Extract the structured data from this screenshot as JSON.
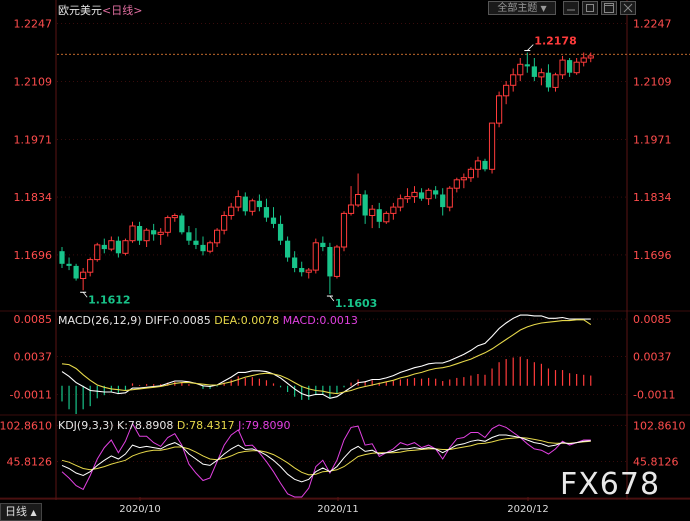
{
  "header": {
    "instrument": "欧元美元",
    "interval": "<日线>",
    "theme_button": "全部主题",
    "dropdown_glyph": "▼"
  },
  "macd_header": {
    "name": "MACD(26,12,9)",
    "diff": "DIFF:0.0085",
    "dea": "DEA:0.0078",
    "macd": "MACD:0.0013"
  },
  "kdj_header": {
    "name": "KDJ(9,3,3)",
    "k": "K:78.8908",
    "d": "D:78.4317",
    "j": "J:79.8090"
  },
  "period_button": "日线",
  "brand": "FX678",
  "colors": {
    "up": "#ff3b3b",
    "down": "#18c48a",
    "diff_line": "#ffffff",
    "dea_line": "#e6d84a",
    "j_line": "#e040e0",
    "axis_text": "#ff4d4d",
    "grid": "#5a1414"
  },
  "chart_data": [
    {
      "type": "candlestick",
      "title": "欧元美元<日线>",
      "y_ticks": [
        "1.2247",
        "1.2109",
        "1.1971",
        "1.1834",
        "1.1696"
      ],
      "ylim": [
        1.1565,
        1.2265
      ],
      "last_price_line": 1.2174,
      "annotations": [
        {
          "label": "1.2178",
          "value": 1.2178,
          "color": "#ff3b3b"
        },
        {
          "label": "1.1612",
          "value": 1.1612,
          "color": "#18c48a"
        },
        {
          "label": "1.1603",
          "value": 1.1603,
          "color": "#18c48a"
        }
      ],
      "x_labels": [
        "2020/10",
        "2020/11",
        "2020/12"
      ],
      "candles": [
        [
          1.1705,
          1.1715,
          1.1665,
          1.1675
        ],
        [
          1.1675,
          1.169,
          1.166,
          1.167
        ],
        [
          1.167,
          1.1675,
          1.1635,
          1.164
        ],
        [
          1.164,
          1.1665,
          1.1612,
          1.1655
        ],
        [
          1.1655,
          1.169,
          1.1645,
          1.1685
        ],
        [
          1.1685,
          1.1725,
          1.168,
          1.172
        ],
        [
          1.172,
          1.1735,
          1.17,
          1.171
        ],
        [
          1.171,
          1.174,
          1.1705,
          1.173
        ],
        [
          1.173,
          1.174,
          1.169,
          1.17
        ],
        [
          1.17,
          1.1735,
          1.1695,
          1.173
        ],
        [
          1.173,
          1.1775,
          1.1725,
          1.1765
        ],
        [
          1.1765,
          1.1775,
          1.172,
          1.173
        ],
        [
          1.173,
          1.176,
          1.1715,
          1.1755
        ],
        [
          1.1755,
          1.177,
          1.173,
          1.1745
        ],
        [
          1.1745,
          1.176,
          1.172,
          1.175
        ],
        [
          1.175,
          1.179,
          1.174,
          1.1785
        ],
        [
          1.1785,
          1.1795,
          1.1775,
          1.179
        ],
        [
          1.179,
          1.1795,
          1.1745,
          1.175
        ],
        [
          1.175,
          1.1765,
          1.172,
          1.173
        ],
        [
          1.173,
          1.176,
          1.171,
          1.172
        ],
        [
          1.172,
          1.174,
          1.1695,
          1.1705
        ],
        [
          1.1705,
          1.173,
          1.17,
          1.1725
        ],
        [
          1.1725,
          1.176,
          1.1715,
          1.1755
        ],
        [
          1.1755,
          1.18,
          1.1745,
          1.179
        ],
        [
          1.179,
          1.182,
          1.178,
          1.181
        ],
        [
          1.181,
          1.185,
          1.18,
          1.1835
        ],
        [
          1.1835,
          1.1845,
          1.179,
          1.18
        ],
        [
          1.18,
          1.183,
          1.179,
          1.1825
        ],
        [
          1.1825,
          1.184,
          1.18,
          1.181
        ],
        [
          1.181,
          1.183,
          1.1775,
          1.1785
        ],
        [
          1.1785,
          1.181,
          1.176,
          1.177
        ],
        [
          1.177,
          1.179,
          1.172,
          1.173
        ],
        [
          1.173,
          1.174,
          1.168,
          1.169
        ],
        [
          1.169,
          1.1705,
          1.1655,
          1.1665
        ],
        [
          1.1665,
          1.168,
          1.1645,
          1.1655
        ],
        [
          1.1655,
          1.1665,
          1.164,
          1.166
        ],
        [
          1.166,
          1.1735,
          1.1652,
          1.1725
        ],
        [
          1.1725,
          1.174,
          1.1705,
          1.1715
        ],
        [
          1.1715,
          1.1725,
          1.1603,
          1.1645
        ],
        [
          1.1645,
          1.172,
          1.164,
          1.1715
        ],
        [
          1.1715,
          1.18,
          1.1705,
          1.1795
        ],
        [
          1.1795,
          1.186,
          1.179,
          1.1815
        ],
        [
          1.1815,
          1.189,
          1.181,
          1.184
        ],
        [
          1.184,
          1.185,
          1.177,
          1.179
        ],
        [
          1.179,
          1.1815,
          1.176,
          1.1805
        ],
        [
          1.1805,
          1.182,
          1.176,
          1.1775
        ],
        [
          1.1775,
          1.18,
          1.177,
          1.1795
        ],
        [
          1.1795,
          1.182,
          1.178,
          1.181
        ],
        [
          1.181,
          1.184,
          1.18,
          1.183
        ],
        [
          1.183,
          1.1855,
          1.182,
          1.1835
        ],
        [
          1.1835,
          1.186,
          1.182,
          1.1845
        ],
        [
          1.1845,
          1.1855,
          1.1825,
          1.183
        ],
        [
          1.183,
          1.1855,
          1.1815,
          1.185
        ],
        [
          1.185,
          1.186,
          1.183,
          1.184
        ],
        [
          1.184,
          1.1855,
          1.179,
          1.181
        ],
        [
          1.181,
          1.186,
          1.18,
          1.1855
        ],
        [
          1.1855,
          1.188,
          1.1845,
          1.1875
        ],
        [
          1.1875,
          1.189,
          1.1855,
          1.188
        ],
        [
          1.188,
          1.1905,
          1.187,
          1.19
        ],
        [
          1.19,
          1.193,
          1.188,
          1.192
        ],
        [
          1.192,
          1.1925,
          1.1895,
          1.19
        ],
        [
          1.19,
          1.201,
          1.189,
          1.201
        ],
        [
          1.201,
          1.2085,
          1.2,
          1.2075
        ],
        [
          1.2075,
          1.211,
          1.2055,
          1.21
        ],
        [
          1.21,
          1.214,
          1.2085,
          1.2125
        ],
        [
          1.2125,
          1.2165,
          1.211,
          1.215
        ],
        [
          1.215,
          1.2178,
          1.213,
          1.2145
        ],
        [
          1.2145,
          1.2165,
          1.211,
          1.212
        ],
        [
          1.212,
          1.214,
          1.21,
          1.213
        ],
        [
          1.213,
          1.215,
          1.2085,
          1.2095
        ],
        [
          1.2095,
          1.213,
          1.2085,
          1.2125
        ],
        [
          1.2125,
          1.217,
          1.2115,
          1.216
        ],
        [
          1.216,
          1.2165,
          1.212,
          1.213
        ],
        [
          1.213,
          1.2165,
          1.2125,
          1.2155
        ],
        [
          1.2155,
          1.2178,
          1.2145,
          1.2165
        ],
        [
          1.2165,
          1.2178,
          1.2155,
          1.217
        ]
      ]
    },
    {
      "type": "bar+line",
      "title": "MACD(26,12,9)",
      "y_ticks": [
        "0.0085",
        "0.0037",
        "-0.0011"
      ],
      "ylim": [
        -0.0036,
        0.0094
      ],
      "macd": [
        -0.002,
        -0.003,
        -0.0036,
        -0.003,
        -0.0026,
        -0.0016,
        -0.0012,
        -0.0008,
        -0.001,
        -0.0006,
        0.0003,
        0.0001,
        0.0002,
        0.0002,
        0.0002,
        0.0004,
        0.0005,
        0.0004,
        0.0002,
        0.0,
        -0.0004,
        -0.0004,
        -0.0001,
        0.0004,
        0.0008,
        0.0012,
        0.001,
        0.0011,
        0.0009,
        0.0007,
        0.0003,
        -0.0002,
        -0.0008,
        -0.0014,
        -0.0018,
        -0.0018,
        -0.0012,
        -0.0011,
        -0.0016,
        -0.001,
        -0.0002,
        0.0004,
        0.0008,
        0.0006,
        0.0007,
        0.0004,
        0.0005,
        0.0006,
        0.0008,
        0.0009,
        0.001,
        0.0009,
        0.001,
        0.0009,
        0.0006,
        0.0008,
        0.001,
        0.0011,
        0.0013,
        0.0015,
        0.0014,
        0.0022,
        0.003,
        0.0034,
        0.0036,
        0.0037,
        0.0034,
        0.003,
        0.0028,
        0.0022,
        0.002,
        0.002,
        0.0016,
        0.0015,
        0.0014,
        0.0013
      ],
      "diff": [
        0.0018,
        0.0012,
        0.0004,
        -0.0001,
        -0.0006,
        -0.0007,
        -0.0008,
        -0.0008,
        -0.001,
        -0.0009,
        -0.0003,
        -0.0003,
        -0.0002,
        -0.0001,
        0.0,
        0.0003,
        0.0006,
        0.0006,
        0.0005,
        0.0003,
        0.0,
        -0.0001,
        0.0001,
        0.0006,
        0.0011,
        0.0017,
        0.0017,
        0.0019,
        0.0019,
        0.0018,
        0.0015,
        0.001,
        0.0003,
        -0.0004,
        -0.001,
        -0.0013,
        -0.0011,
        -0.0011,
        -0.0016,
        -0.0014,
        -0.0008,
        -0.0002,
        0.0004,
        0.0005,
        0.0008,
        0.0008,
        0.001,
        0.0013,
        0.0017,
        0.002,
        0.0023,
        0.0025,
        0.0028,
        0.0029,
        0.0029,
        0.0032,
        0.0036,
        0.004,
        0.0045,
        0.0051,
        0.0054,
        0.0063,
        0.0073,
        0.008,
        0.0086,
        0.009,
        0.009,
        0.0089,
        0.0089,
        0.0086,
        0.0086,
        0.0087,
        0.0085,
        0.0085,
        0.0085,
        0.0085
      ],
      "dea": [
        0.0028,
        0.0027,
        0.0022,
        0.0014,
        0.0007,
        0.0001,
        -0.0002,
        -0.0004,
        -0.0005,
        -0.0006,
        -0.0005,
        -0.0004,
        -0.0003,
        -0.0002,
        -0.0001,
        0.0001,
        0.0003,
        0.0004,
        0.0004,
        0.0003,
        0.0002,
        0.0001,
        0.0001,
        0.0003,
        0.0005,
        0.0008,
        0.0011,
        0.0013,
        0.0015,
        0.0016,
        0.0015,
        0.0013,
        0.0009,
        0.0004,
        -0.0001,
        -0.0004,
        -0.0006,
        -0.0007,
        -0.0009,
        -0.001,
        -0.0008,
        -0.0006,
        -0.0003,
        -0.0001,
        0.0001,
        0.0003,
        0.0005,
        0.0007,
        0.001,
        0.0012,
        0.0015,
        0.0017,
        0.002,
        0.0022,
        0.0023,
        0.0025,
        0.0028,
        0.0031,
        0.0034,
        0.0038,
        0.0042,
        0.0047,
        0.0053,
        0.0059,
        0.0065,
        0.0071,
        0.0075,
        0.0078,
        0.008,
        0.0081,
        0.0082,
        0.0083,
        0.0083,
        0.0084,
        0.0084,
        0.0078
      ]
    },
    {
      "type": "line",
      "title": "KDJ(9,3,3)",
      "y_ticks": [
        "102.8610",
        "45.8126"
      ],
      "ylim": [
        -10,
        118
      ],
      "k": [
        40,
        35,
        28,
        24,
        30,
        40,
        48,
        55,
        50,
        58,
        72,
        68,
        70,
        68,
        66,
        72,
        76,
        70,
        58,
        50,
        42,
        40,
        48,
        58,
        66,
        72,
        65,
        66,
        62,
        56,
        48,
        38,
        26,
        18,
        14,
        18,
        30,
        36,
        30,
        38,
        52,
        64,
        70,
        62,
        64,
        58,
        60,
        62,
        66,
        66,
        68,
        66,
        68,
        66,
        60,
        66,
        72,
        74,
        78,
        80,
        78,
        84,
        88,
        88,
        86,
        84,
        80,
        76,
        74,
        70,
        72,
        76,
        74,
        76,
        78,
        79
      ],
      "d": [
        48,
        45,
        40,
        35,
        33,
        35,
        38,
        42,
        45,
        48,
        55,
        59,
        62,
        64,
        64,
        66,
        69,
        69,
        66,
        61,
        55,
        50,
        49,
        51,
        55,
        60,
        62,
        63,
        63,
        61,
        57,
        51,
        44,
        36,
        29,
        25,
        26,
        30,
        31,
        33,
        38,
        46,
        54,
        57,
        59,
        60,
        60,
        60,
        61,
        63,
        64,
        65,
        66,
        66,
        65,
        65,
        67,
        69,
        71,
        74,
        75,
        77,
        80,
        82,
        83,
        84,
        83,
        81,
        79,
        76,
        75,
        75,
        75,
        76,
        77,
        78
      ],
      "j": [
        30,
        20,
        8,
        2,
        24,
        50,
        68,
        80,
        60,
        78,
        106,
        86,
        86,
        76,
        70,
        84,
        90,
        72,
        42,
        28,
        16,
        20,
        46,
        72,
        88,
        96,
        71,
        72,
        60,
        46,
        30,
        12,
        -5,
        -10,
        -10,
        4,
        38,
        48,
        28,
        48,
        80,
        100,
        102,
        72,
        74,
        54,
        60,
        66,
        76,
        72,
        76,
        68,
        72,
        66,
        50,
        68,
        82,
        84,
        92,
        92,
        84,
        98,
        104,
        100,
        92,
        84,
        74,
        66,
        64,
        58,
        66,
        78,
        72,
        76,
        80,
        80
      ]
    }
  ]
}
